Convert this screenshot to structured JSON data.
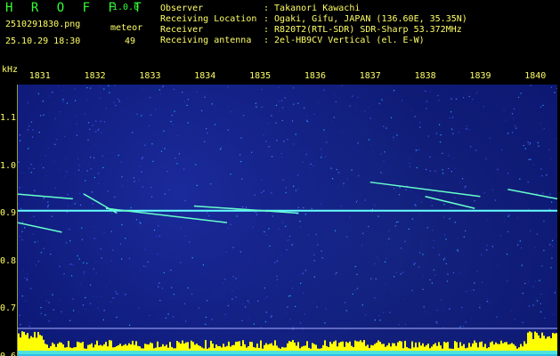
{
  "header": {
    "app_title": "H R O F F T",
    "app_version": "1.0.0",
    "file_name": "2510291830.png",
    "meteor_label": "meteor",
    "date_time": "25.10.29 18:30",
    "meteor_count": "49"
  },
  "info": {
    "observer_label": "Observer",
    "observer_value": ": Takanori Kawachi",
    "location_label": "Receiving Location",
    "location_value": ": Ogaki, Gifu, JAPAN (136.60E, 35.35N)",
    "receiver_label": "Receiver",
    "receiver_value": ": R820T2(RTL-SDR) SDR-Sharp 53.372MHz",
    "antenna_label": "Receiving antenna",
    "antenna_value": ": 2el-HB9CV Vertical (el. E-W)"
  },
  "chart_data": {
    "type": "heatmap",
    "y_unit": "kHz",
    "x_ticks": [
      "1831",
      "1832",
      "1833",
      "1834",
      "1835",
      "1836",
      "1837",
      "1838",
      "1839",
      "1840"
    ],
    "y_ticks": [
      "1.1",
      "1.0",
      "0.9",
      "0.8",
      "0.7",
      "0.6"
    ],
    "xlim": [
      1830.6,
      1840.4
    ],
    "ylim": [
      0.6,
      1.17
    ],
    "carrier_khz": 0.905,
    "meteor_echoes": [
      {
        "x0": 1830.6,
        "y0": 0.94,
        "x1": 1831.6,
        "y1": 0.93
      },
      {
        "x0": 1831.8,
        "y0": 0.94,
        "x1": 1832.4,
        "y1": 0.9
      },
      {
        "x0": 1832.2,
        "y0": 0.91,
        "x1": 1834.4,
        "y1": 0.88
      },
      {
        "x0": 1833.8,
        "y0": 0.915,
        "x1": 1835.7,
        "y1": 0.9
      },
      {
        "x0": 1837.0,
        "y0": 0.965,
        "x1": 1839.0,
        "y1": 0.935
      },
      {
        "x0": 1838.0,
        "y0": 0.935,
        "x1": 1838.9,
        "y1": 0.91
      },
      {
        "x0": 1839.5,
        "y0": 0.95,
        "x1": 1840.4,
        "y1": 0.93
      },
      {
        "x0": 1830.6,
        "y0": 0.88,
        "x1": 1831.4,
        "y1": 0.86
      }
    ],
    "colors": {
      "background": "#0b1670",
      "carrier": "#66ffff",
      "echo": "#66ffcc",
      "level_bar": "#ffff00",
      "level_base": "#33ddff",
      "axis_text": "#ffff66"
    }
  }
}
